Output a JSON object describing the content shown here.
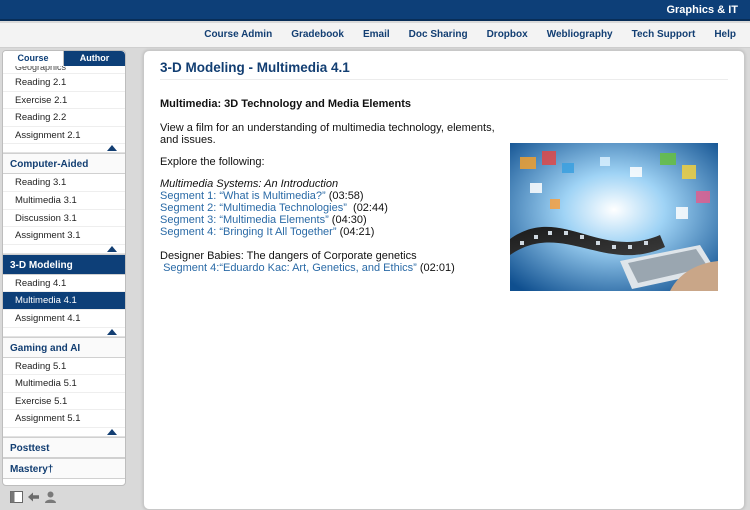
{
  "header": {
    "brand": "Graphics & IT"
  },
  "nav": [
    "Course Admin",
    "Gradebook",
    "Email",
    "Doc Sharing",
    "Dropbox",
    "Webliography",
    "Tech Support",
    "Help"
  ],
  "sidebar": {
    "tabs": [
      "Course",
      "Author"
    ],
    "clipped_item": "Geographics",
    "groups": [
      {
        "items": [
          "Reading 2.1",
          "Exercise 2.1",
          "Reading 2.2",
          "Assignment 2.1"
        ]
      },
      {
        "title": "Computer-Aided",
        "items": [
          "Reading 3.1",
          "Multimedia 3.1",
          "Discussion 3.1",
          "Assignment 3.1"
        ]
      },
      {
        "title": "3-D Modeling",
        "items": [
          "Reading 4.1",
          "Multimedia 4.1",
          "Assignment 4.1"
        ]
      },
      {
        "title": "Gaming and AI",
        "items": [
          "Reading 5.1",
          "Multimedia 5.1",
          "Exercise 5.1",
          "Assignment 5.1"
        ]
      }
    ],
    "posttest": "Posttest",
    "mastery": "Mastery†"
  },
  "content": {
    "title": "3-D Modeling - Multimedia 4.1",
    "subheading": "Multimedia: 3D Technology and Media Elements",
    "intro": "View a film for an understanding of multimedia technology, elements, and issues.",
    "explore": "Explore the following:",
    "series_title": "Multimedia Systems: An Introduction",
    "segments": [
      {
        "label": "Segment 1: “What is Multimedia?”",
        "time": "(03:58)"
      },
      {
        "label": "Segment 2: “Multimedia Technologies”",
        "time": "(02:44)"
      },
      {
        "label": "Segment 3: “Multimedia Elements”",
        "time": "(04:30)"
      },
      {
        "label": "Segment 4: “Bringing It All Together”",
        "time": "(04:21)"
      }
    ],
    "designer_heading": "Designer Babies: The dangers of Corporate genetics",
    "designer_segment": {
      "label": "Segment 4:“Eduardo Kac: Art, Genetics, and Ethics”",
      "time": "(02:01)"
    }
  },
  "colors": {
    "brand_blue": "#0d3f78",
    "link_blue": "#2a6aa6"
  }
}
